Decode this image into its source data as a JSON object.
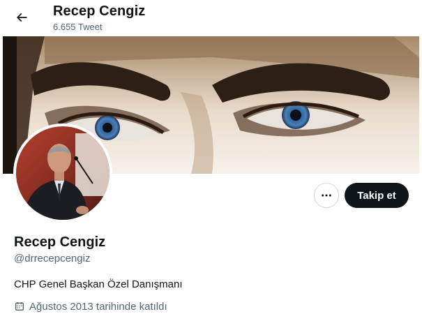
{
  "header": {
    "title": "Recep Cengiz",
    "tweet_count": "6.655 Tweet",
    "back_icon": "arrow-left-icon"
  },
  "banner": {
    "description_icon": "eyes-banner-image",
    "iris_color": "#4a7fb8"
  },
  "profile": {
    "avatar_icon": "avatar-photo",
    "name": "Recep Cengiz",
    "handle": "@drrecepcengiz",
    "bio": "CHP Genel Başkan Özel Danışmanı",
    "joined": "Ağustos 2013 tarihinde katıldı",
    "joined_icon": "calendar-icon"
  },
  "actions": {
    "more_icon": "more-dots-icon",
    "follow_label": "Takip et"
  },
  "colors": {
    "text_primary": "#0f1419",
    "text_secondary": "#536471",
    "follow_bg": "#0f1419",
    "border": "#cfd9de"
  }
}
